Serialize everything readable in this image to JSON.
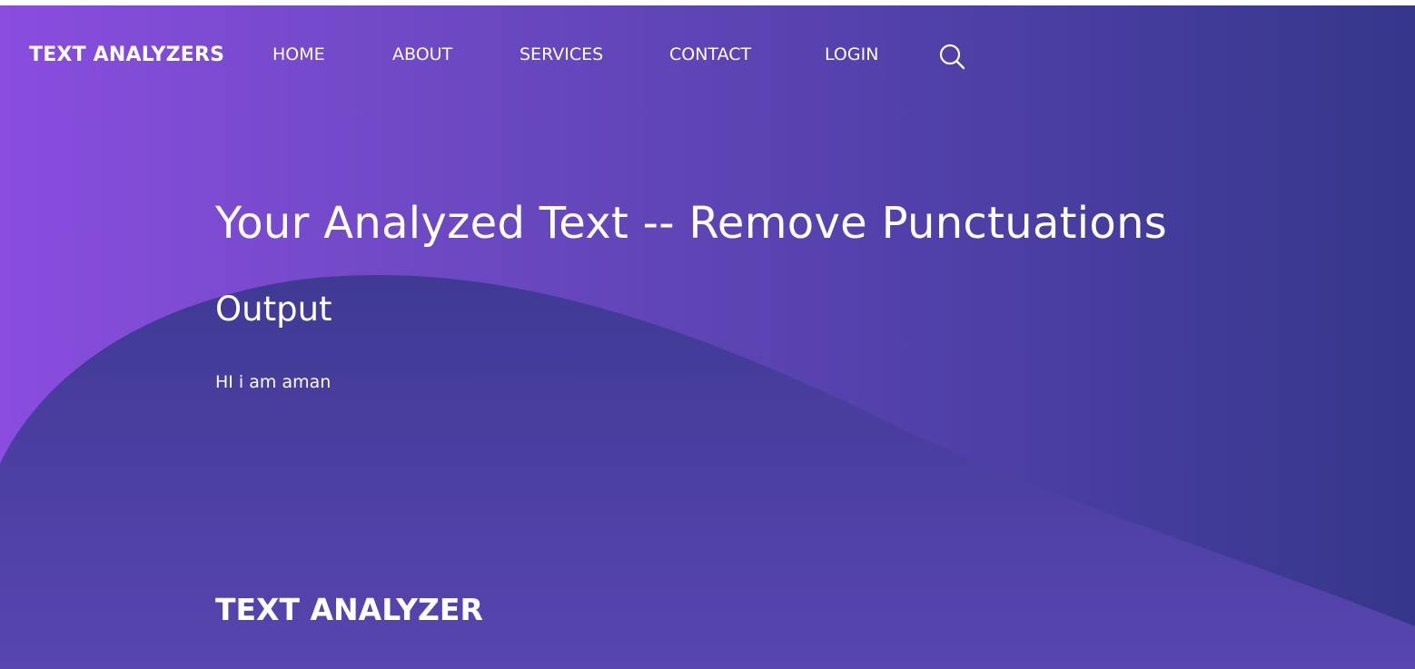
{
  "brand": "TEXT ANALYZERS",
  "nav": {
    "home": "HOME",
    "about": "ABOUT",
    "services": "SERVICES",
    "contact": "CONTACT",
    "login": "LOGIN",
    "search_icon": "search-icon"
  },
  "main": {
    "title": "Your Analyzed Text -- Remove Punctuations",
    "subtitle": "Output",
    "output_text": "HI i am aman"
  },
  "footer": {
    "title": "TEXT ANALYZER"
  },
  "colors": {
    "gradient_start": "#8a4ddf",
    "gradient_end": "#35378a",
    "wave": "#4a3f9f",
    "text": "#ffffff"
  }
}
